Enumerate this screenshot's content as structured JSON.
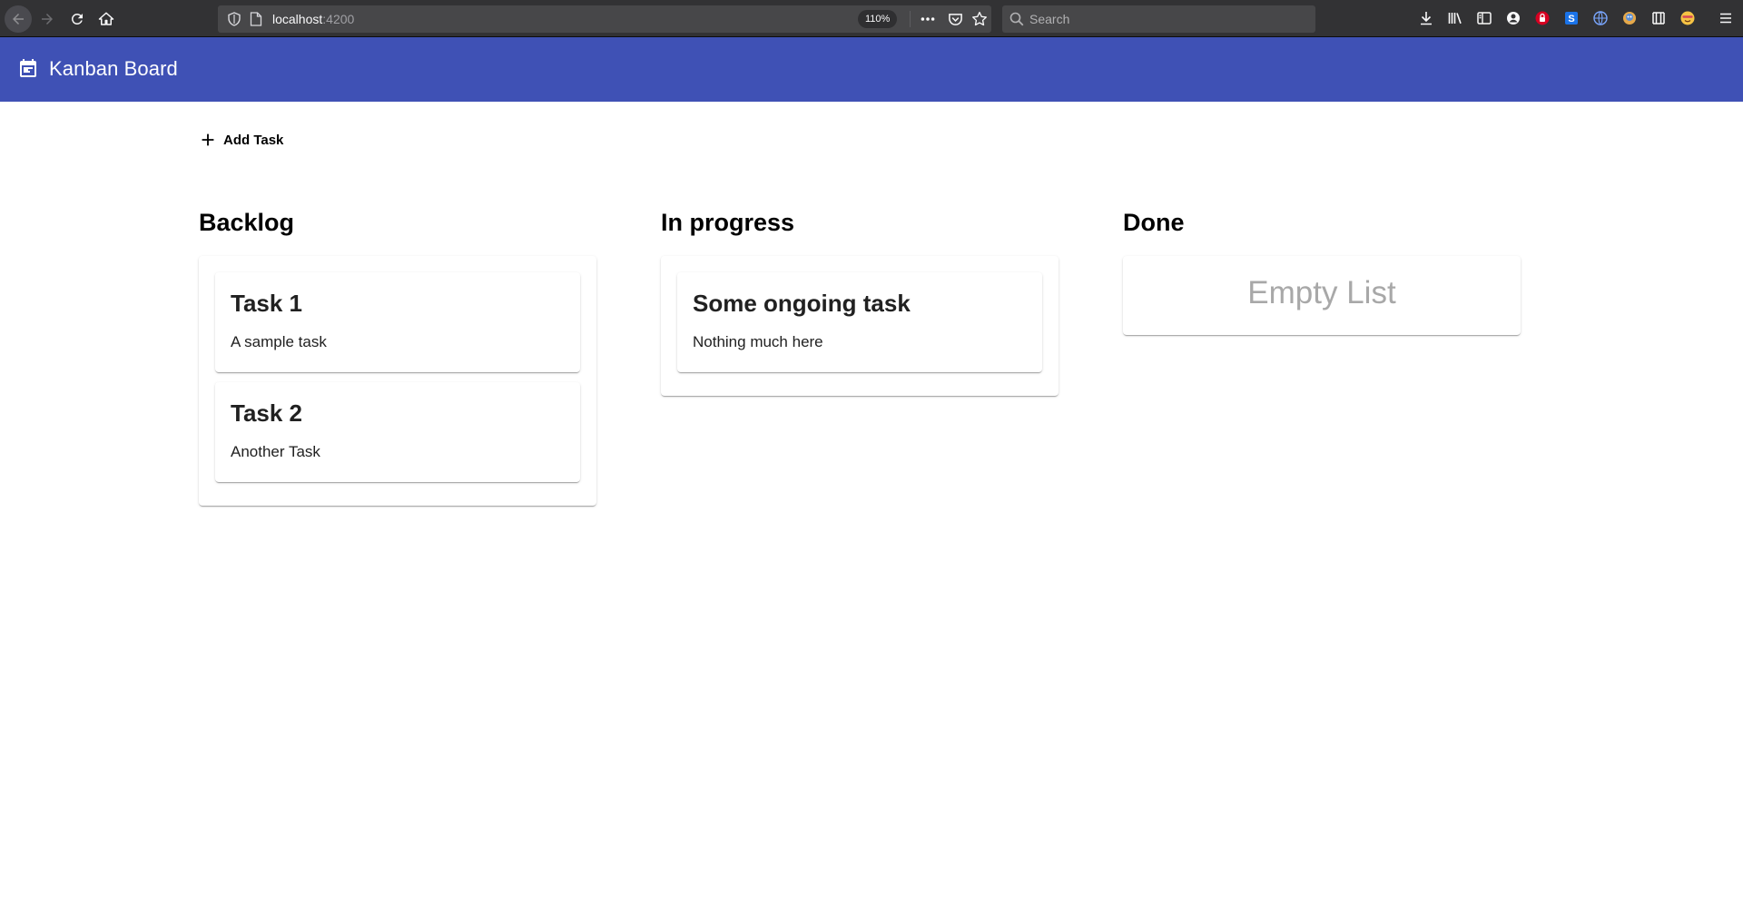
{
  "browser": {
    "url_host": "localhost",
    "url_port": ":4200",
    "zoom": "110%",
    "search_placeholder": "Search",
    "toolbar_icons": [
      "download-icon",
      "library-icon",
      "sidebar-icon",
      "account-icon",
      "extension-lock-icon",
      "extension-s-icon",
      "extension-globe-icon",
      "extension-avatar-icon",
      "extension-grid-icon",
      "extension-emoji-icon",
      "menu-icon"
    ]
  },
  "app": {
    "title": "Kanban Board",
    "toolbar_color": "#3f51b5",
    "add_task_label": "Add Task"
  },
  "columns": [
    {
      "title": "Backlog",
      "tasks": [
        {
          "title": "Task 1",
          "description": "A sample task"
        },
        {
          "title": "Task 2",
          "description": "Another Task"
        }
      ]
    },
    {
      "title": "In progress",
      "tasks": [
        {
          "title": "Some ongoing task",
          "description": "Nothing much here"
        }
      ]
    },
    {
      "title": "Done",
      "tasks": [],
      "empty_text": "Empty List"
    }
  ]
}
